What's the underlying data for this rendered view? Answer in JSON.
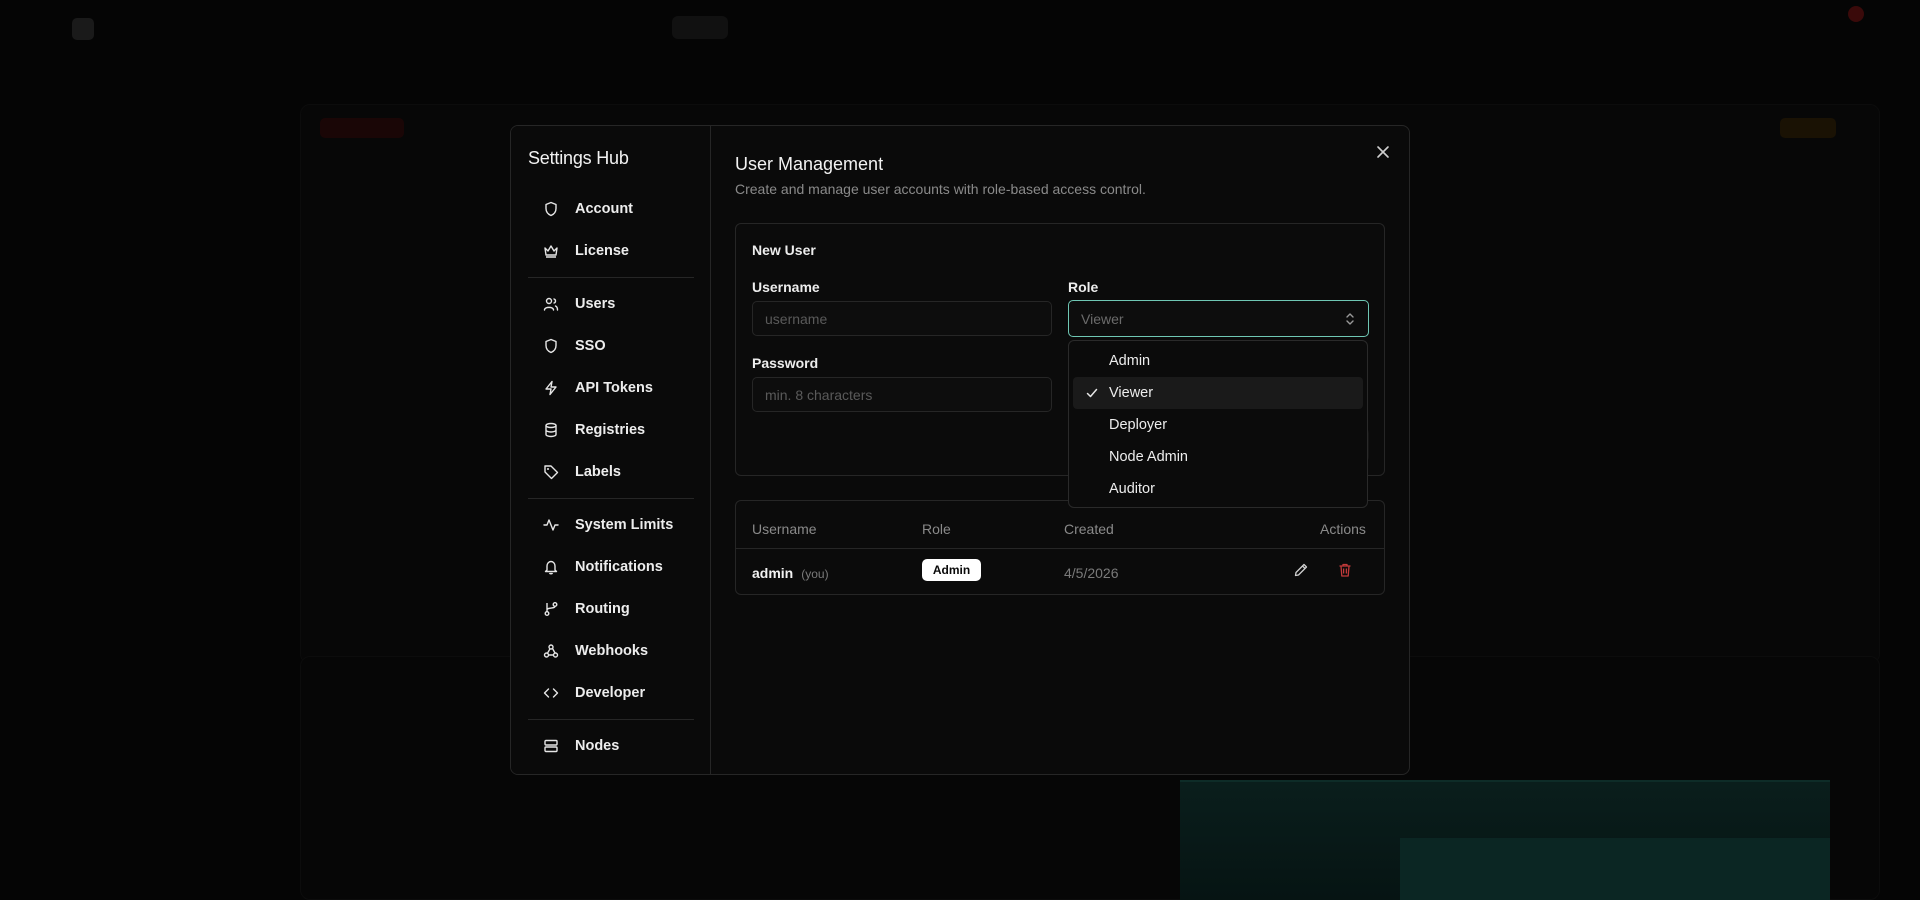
{
  "settings": {
    "title": "Settings Hub",
    "nav_groups": [
      [
        {
          "label": "Account",
          "icon": "shield-icon"
        },
        {
          "label": "License",
          "icon": "crown-icon"
        }
      ],
      [
        {
          "label": "Users",
          "icon": "users-icon"
        },
        {
          "label": "SSO",
          "icon": "shield-icon"
        },
        {
          "label": "API Tokens",
          "icon": "bolt-icon"
        },
        {
          "label": "Registries",
          "icon": "database-icon"
        },
        {
          "label": "Labels",
          "icon": "tag-icon"
        }
      ],
      [
        {
          "label": "System Limits",
          "icon": "activity-icon"
        },
        {
          "label": "Notifications",
          "icon": "bell-icon"
        },
        {
          "label": "Routing",
          "icon": "git-branch-icon"
        },
        {
          "label": "Webhooks",
          "icon": "webhook-icon"
        },
        {
          "label": "Developer",
          "icon": "code-icon"
        }
      ],
      [
        {
          "label": "Nodes",
          "icon": "server-icon"
        }
      ]
    ]
  },
  "user_management": {
    "title": "User Management",
    "description": "Create and manage user accounts with role-based access control.",
    "new_user": {
      "title": "New User",
      "username_label": "Username",
      "username_placeholder": "username",
      "role_label": "Role",
      "role_value": "Viewer",
      "password_label": "Password",
      "password_placeholder": "min. 8 characters"
    },
    "role_options": [
      "Admin",
      "Viewer",
      "Deployer",
      "Node Admin",
      "Auditor"
    ],
    "selected_role": "Viewer",
    "table": {
      "headers": [
        "Username",
        "Role",
        "Created",
        "Actions"
      ],
      "rows": [
        {
          "username": "admin",
          "tag": "(you)",
          "role": "Admin",
          "created": "4/5/2026"
        }
      ]
    }
  },
  "colors": {
    "accent": "#6fc7b4",
    "danger": "#c23a3a",
    "background": "#0a0a0a"
  }
}
